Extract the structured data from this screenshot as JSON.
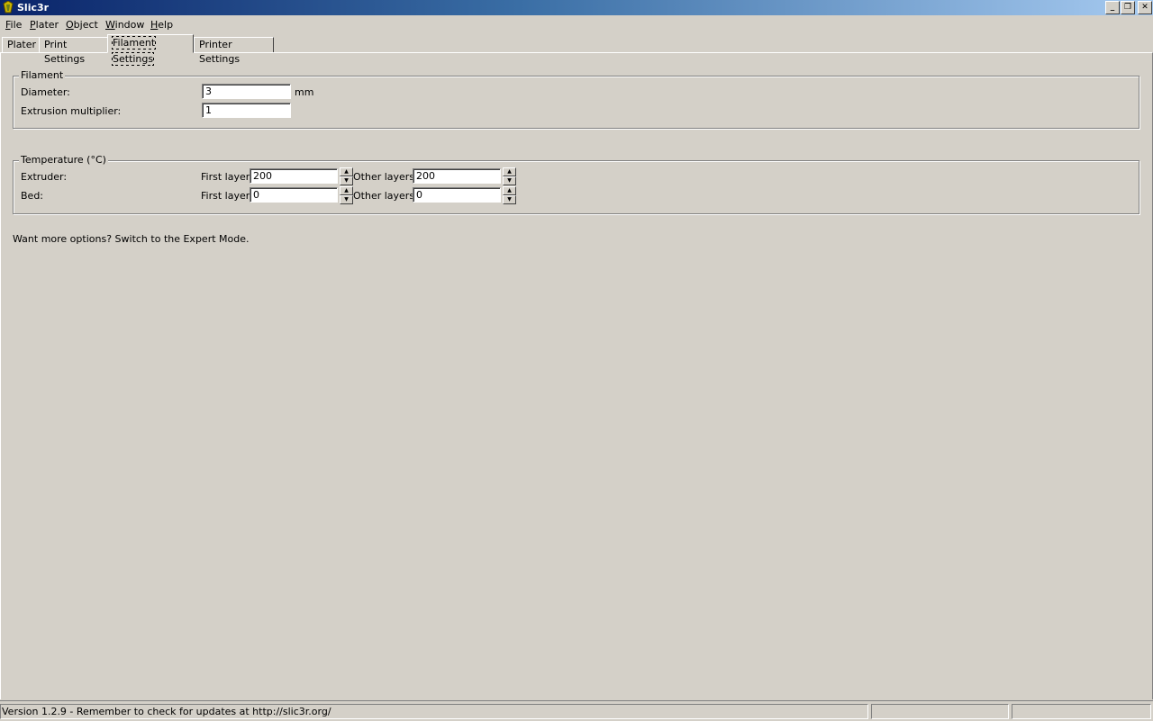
{
  "window": {
    "title": "Slic3r",
    "minimize_glyph": "_",
    "maximize_glyph": "❐",
    "close_glyph": "✕",
    "icon": "slic3r-logo-icon"
  },
  "menu": {
    "items": [
      {
        "first": "F",
        "rest": "ile"
      },
      {
        "first": "P",
        "rest": "later"
      },
      {
        "first": "O",
        "rest": "bject"
      },
      {
        "first": "W",
        "rest": "indow"
      },
      {
        "first": "H",
        "rest": "elp"
      }
    ]
  },
  "tabs": [
    {
      "label": "Plater"
    },
    {
      "label": "Print Settings"
    },
    {
      "label": "Filament Settings",
      "active": true
    },
    {
      "label": "Printer Settings"
    }
  ],
  "filament": {
    "legend": "Filament",
    "diameter_label": "Diameter:",
    "diameter_value": "3",
    "diameter_unit": "mm",
    "multiplier_label": "Extrusion multiplier:",
    "multiplier_value": "1"
  },
  "temperature": {
    "legend": "Temperature (°C)",
    "extruder_label": "Extruder:",
    "bed_label": "Bed:",
    "first_layer_label": "First layer:",
    "other_layers_label": "Other layers:",
    "extruder_first": "200",
    "extruder_other": "200",
    "bed_first": "0",
    "bed_other": "0",
    "spin_up": "▲",
    "spin_down": "▼"
  },
  "hint": "Want more options? Switch to the Expert Mode.",
  "status": {
    "text": "Version 1.2.9 - Remember to check for updates at http://slic3r.org/",
    "cell2": "",
    "cell3": ""
  }
}
